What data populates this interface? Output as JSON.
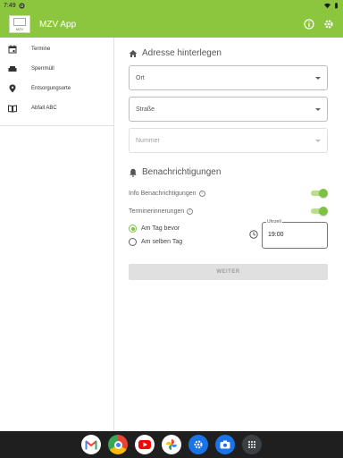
{
  "status_bar": {
    "time": "7:49"
  },
  "app_bar": {
    "title": "MZV App",
    "logo_text": "MZV"
  },
  "sidebar": {
    "items": [
      {
        "label": "Termine",
        "icon": "calendar-icon"
      },
      {
        "label": "Sperrmüll",
        "icon": "sofa-icon"
      },
      {
        "label": "Entsorgungsorte",
        "icon": "location-pin-icon"
      },
      {
        "label": "Abfall ABC",
        "icon": "book-icon"
      }
    ]
  },
  "main": {
    "address": {
      "heading": "Adresse hinterlegen",
      "ort_placeholder": "Ort",
      "strasse_placeholder": "Straße",
      "nummer_placeholder": "Nummer"
    },
    "notifications": {
      "heading": "Benachrichtigungen",
      "info_label": "Info Benachrichtigungen",
      "info_enabled": true,
      "reminder_label": "Terminerinnerungen",
      "reminder_enabled": true,
      "option_day_before": "Am Tag bevor",
      "option_same_day": "Am selben Tag",
      "selected_option": "Am Tag bevor",
      "time_label": "Uhrzeit",
      "time_value": "19:00"
    },
    "submit_label": "WEITER"
  },
  "colors": {
    "accent": "#8cc63f",
    "switch_active": "#7dc242"
  },
  "taskbar": {
    "apps": [
      "gmail-icon",
      "chrome-icon",
      "youtube-icon",
      "photos-icon",
      "settings-icon",
      "camera-icon",
      "app-drawer-icon"
    ]
  }
}
